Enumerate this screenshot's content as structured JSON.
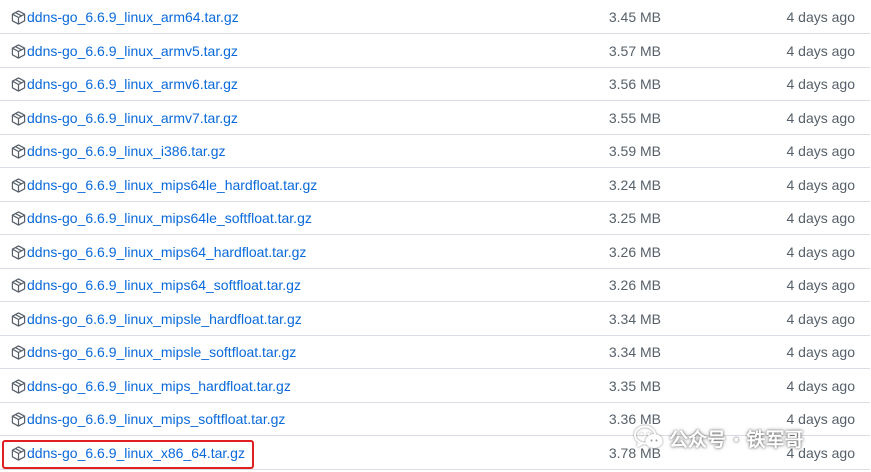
{
  "assets": [
    {
      "name": "ddns-go_6.6.9_linux_arm64.tar.gz",
      "size": "3.45 MB",
      "date": "4 days ago"
    },
    {
      "name": "ddns-go_6.6.9_linux_armv5.tar.gz",
      "size": "3.57 MB",
      "date": "4 days ago"
    },
    {
      "name": "ddns-go_6.6.9_linux_armv6.tar.gz",
      "size": "3.56 MB",
      "date": "4 days ago"
    },
    {
      "name": "ddns-go_6.6.9_linux_armv7.tar.gz",
      "size": "3.55 MB",
      "date": "4 days ago"
    },
    {
      "name": "ddns-go_6.6.9_linux_i386.tar.gz",
      "size": "3.59 MB",
      "date": "4 days ago"
    },
    {
      "name": "ddns-go_6.6.9_linux_mips64le_hardfloat.tar.gz",
      "size": "3.24 MB",
      "date": "4 days ago"
    },
    {
      "name": "ddns-go_6.6.9_linux_mips64le_softfloat.tar.gz",
      "size": "3.25 MB",
      "date": "4 days ago"
    },
    {
      "name": "ddns-go_6.6.9_linux_mips64_hardfloat.tar.gz",
      "size": "3.26 MB",
      "date": "4 days ago"
    },
    {
      "name": "ddns-go_6.6.9_linux_mips64_softfloat.tar.gz",
      "size": "3.26 MB",
      "date": "4 days ago"
    },
    {
      "name": "ddns-go_6.6.9_linux_mipsle_hardfloat.tar.gz",
      "size": "3.34 MB",
      "date": "4 days ago"
    },
    {
      "name": "ddns-go_6.6.9_linux_mipsle_softfloat.tar.gz",
      "size": "3.34 MB",
      "date": "4 days ago"
    },
    {
      "name": "ddns-go_6.6.9_linux_mips_hardfloat.tar.gz",
      "size": "3.35 MB",
      "date": "4 days ago"
    },
    {
      "name": "ddns-go_6.6.9_linux_mips_softfloat.tar.gz",
      "size": "3.36 MB",
      "date": "4 days ago"
    },
    {
      "name": "ddns-go_6.6.9_linux_x86_64.tar.gz",
      "size": "3.78 MB",
      "date": "4 days ago",
      "highlighted": true
    }
  ],
  "icons": {
    "asset": "package-icon",
    "watermark": "wechat-icon"
  },
  "watermark": {
    "text": "公众号 · 铁军哥"
  },
  "colors": {
    "link": "#0969da",
    "muted": "#57606a",
    "border": "#d8dee4",
    "highlight": "#e02020"
  }
}
